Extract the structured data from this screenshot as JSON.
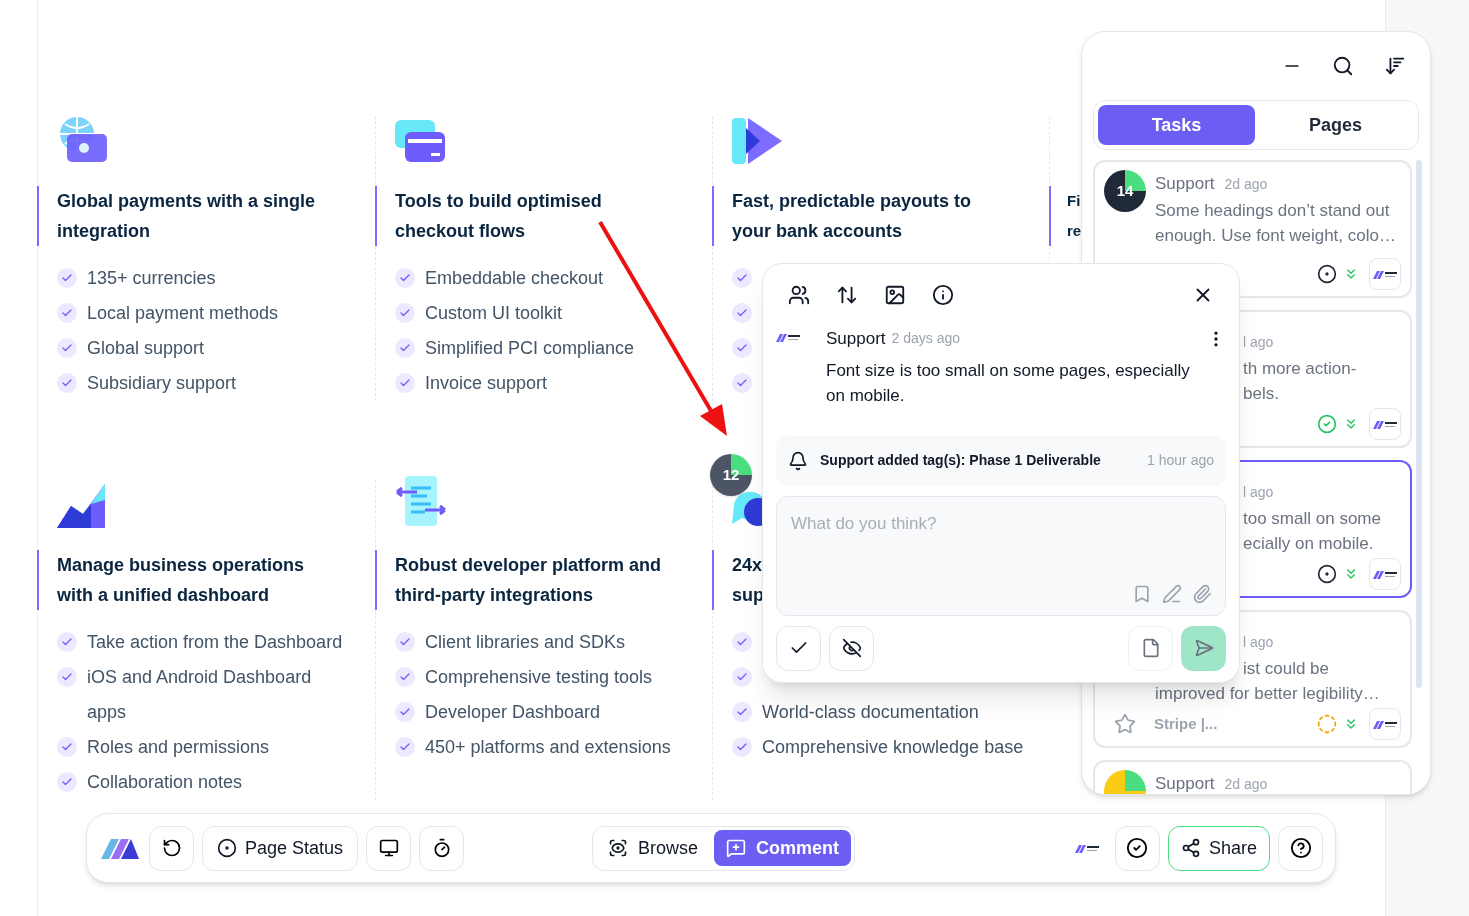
{
  "feature_rows": [
    [
      {
        "kind": "full",
        "heading": [
          "Global payments with a single",
          "integration"
        ],
        "items": [
          {
            "kind": "text",
            "text": "135+ currencies"
          },
          {
            "kind": "text",
            "text": "Local payment methods"
          },
          {
            "kind": "text",
            "text": "Global support"
          },
          {
            "kind": "text",
            "text": "Subsidiary support"
          }
        ]
      },
      {
        "kind": "full",
        "heading": [
          "Tools to build optimised",
          "checkout flows"
        ],
        "items": [
          {
            "kind": "text",
            "text": "Embeddable checkout"
          },
          {
            "kind": "text",
            "text": "Custom UI toolkit"
          },
          {
            "kind": "text",
            "text": "Simplified PCI compliance"
          },
          {
            "kind": "text",
            "text": "Invoice support"
          }
        ]
      },
      {
        "kind": "full",
        "heading": [
          "Fast, predictable payouts to",
          "your bank accounts"
        ],
        "items": [
          {
            "kind": "covered"
          },
          {
            "kind": "covered"
          },
          {
            "kind": "covered"
          },
          {
            "kind": "covered"
          }
        ]
      },
      {
        "kind": "clipped",
        "heading": [
          "Fi",
          "re"
        ]
      }
    ],
    [
      {
        "kind": "full",
        "heading": [
          "Manage business operations",
          "with a unified dashboard"
        ],
        "items": [
          {
            "kind": "text",
            "text": "Take action from the Dashboard"
          },
          {
            "kind": "text",
            "text": "iOS and Android Dashboard apps"
          },
          {
            "kind": "text",
            "text": "Roles and permissions"
          },
          {
            "kind": "text",
            "text": "Collaboration notes"
          }
        ]
      },
      {
        "kind": "full",
        "heading": [
          "Robust developer platform and",
          "third-party integrations"
        ],
        "items": [
          {
            "kind": "text",
            "text": "Client libraries and SDKs"
          },
          {
            "kind": "text",
            "text": "Comprehensive testing tools"
          },
          {
            "kind": "text",
            "text": "Developer Dashboard"
          },
          {
            "kind": "text",
            "text": "450+ platforms and extensions"
          }
        ]
      },
      {
        "kind": "full",
        "heading": [
          "24x",
          "sup"
        ],
        "items": [
          {
            "kind": "covered"
          },
          {
            "kind": "covered"
          },
          {
            "kind": "text",
            "text": "World-class documentation"
          },
          {
            "kind": "text",
            "text": "Comprehensive knowledge base"
          }
        ]
      }
    ]
  ],
  "marker": {
    "count": "12"
  },
  "panel": {
    "tabs": [
      {
        "label": "Tasks",
        "selected": true
      },
      {
        "label": "Pages",
        "selected": false
      }
    ],
    "cards": [
      {
        "kind": "full",
        "selected": false,
        "avatar": {
          "count": "14",
          "color": "#1f2937"
        },
        "author": "Support",
        "time": "2d ago",
        "lines": [
          {
            "text": "Some headings don’t stand out",
            "covered": false
          },
          {
            "text": "enough. Use font weight, colo…",
            "covered": false
          }
        ],
        "status": {
          "kind": "open"
        }
      },
      {
        "kind": "partial",
        "selected": false,
        "time": "l ago",
        "lines": [
          {
            "text": "th more action-",
            "covered": true
          },
          {
            "text": "bels.",
            "covered": true
          }
        ],
        "status": {
          "kind": "resolved"
        }
      },
      {
        "kind": "partial",
        "selected": true,
        "time": "l ago",
        "lines": [
          {
            "text": "too small on some",
            "covered": true
          },
          {
            "text": "ecially on mobile.",
            "covered": true
          }
        ],
        "status": {
          "kind": "open"
        }
      },
      {
        "kind": "partial",
        "selected": false,
        "time": "l ago",
        "lines": [
          {
            "text": "ist could be",
            "covered": true
          },
          {
            "text": "improved for better legibility…",
            "covered": false
          }
        ],
        "footer_label": "Stripe |...",
        "status": {
          "kind": "pending"
        }
      },
      {
        "kind": "cut",
        "selected": false,
        "avatar": {
          "color": "#facc15"
        },
        "author": "Support",
        "time": "2d ago"
      }
    ]
  },
  "popup": {
    "author": "Support",
    "time": "2 days ago",
    "text": "Font size is too small on some pages, especially on mobile.",
    "activity": {
      "text": "Support added tag(s): Phase 1 Deliverable",
      "time": "1 hour ago"
    },
    "reply": {
      "placeholder": "What do you think?"
    },
    "send_disabled": true
  },
  "toolbar": {
    "page_status": "Page Status",
    "modes": [
      {
        "label": "Browse",
        "selected": false
      },
      {
        "label": "Comment",
        "selected": true
      }
    ],
    "share": "Share"
  }
}
